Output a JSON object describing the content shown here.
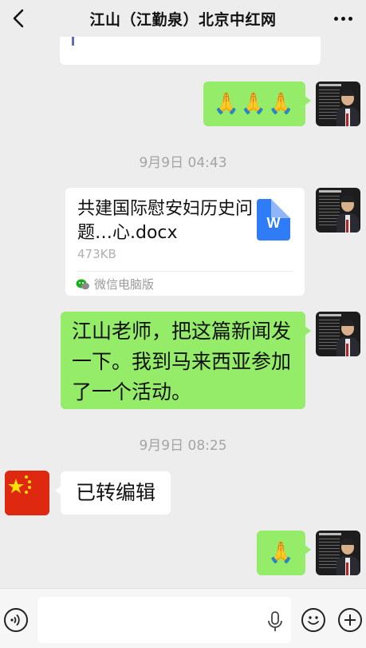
{
  "header": {
    "title": "江山（江勤泉）北京中红网"
  },
  "messages": {
    "top_partial": {
      "sender": "other",
      "type": "text",
      "text": ""
    },
    "m1": {
      "sender": "me",
      "type": "emoji",
      "text": "🙏🙏🙏"
    },
    "ts1": "9月9日 04:43",
    "m2": {
      "sender": "me",
      "type": "file",
      "title": "共建国际慰安妇历史问题…心.docx",
      "size": "473KB",
      "source": "微信电脑版",
      "file_icon_letter": "W"
    },
    "m3": {
      "sender": "me",
      "type": "text",
      "text": "江山老师，把这篇新闻发一下。我到马来西亚参加了一个活动。"
    },
    "ts2": "9月9日 08:25",
    "m4": {
      "sender": "other",
      "type": "text",
      "text": "已转编辑"
    },
    "m5": {
      "sender": "me",
      "type": "emoji",
      "text": "🙏"
    }
  },
  "input": {
    "value": "",
    "placeholder": ""
  },
  "icons": [
    "back-icon",
    "more-icon",
    "voice-icon",
    "mic-icon",
    "emoji-icon",
    "plus-icon",
    "word-file-icon",
    "wechat-pc-icon"
  ],
  "colors": {
    "my_bubble": "#95ec69",
    "other_bubble": "#ffffff",
    "background": "#ededed",
    "word_blue": "#2f7cf6"
  }
}
